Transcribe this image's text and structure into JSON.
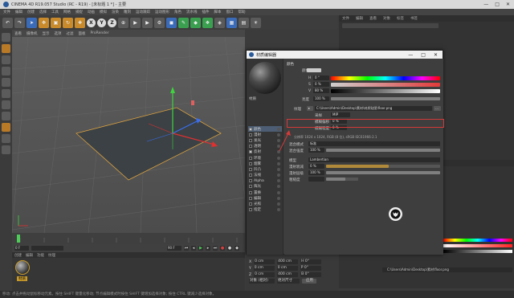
{
  "window": {
    "title": "CINEMA 4D R19.057 Studio (RC - R19) - [未标题 1 *] - 主要",
    "buttons": [
      "—",
      "□",
      "✕"
    ]
  },
  "menubar": [
    "文件",
    "编辑",
    "创建",
    "选择",
    "工具",
    "网格",
    "捕捉",
    "动画",
    "模拟",
    "渲染",
    "雕刻",
    "运动跟踪",
    "运动图形",
    "角色",
    "流水线",
    "插件",
    "脚本",
    "窗口",
    "帮助"
  ],
  "toolbar": {
    "xyz": [
      "X",
      "Y",
      "Z"
    ]
  },
  "viewport": {
    "menu": [
      "查看",
      "摄像机",
      "显示",
      "选项",
      "过滤",
      "面板",
      "ProRender"
    ]
  },
  "timeline": {
    "start_field": "0 F",
    "end_field": "90 F",
    "current_field": "90 F"
  },
  "material_manager": {
    "menu": [
      "创建",
      "编辑",
      "功能",
      "纹理"
    ],
    "material_label": "材质"
  },
  "coordinates": {
    "rows": [
      {
        "axis": "X",
        "pos": "0 cm",
        "size": "400 cm",
        "rot": "H 0°"
      },
      {
        "axis": "Y",
        "pos": "0 cm",
        "size": "0 cm",
        "rot": "P 0°"
      },
      {
        "axis": "Z",
        "pos": "0 cm",
        "size": "400 cm",
        "rot": "B 0°"
      }
    ],
    "mode": "对象 (相对)",
    "size_mode": "绝对尺寸",
    "apply": "应用"
  },
  "status": "移动: 点击并拖动鼠标移动元素。按住 SHIFT 键量化移动; 节点编辑模式时按住 SHIFT 键增加选择对象; 按住 CTRL 键减少选择对象。",
  "dialog": {
    "title": "材质编辑器",
    "controls": [
      "—",
      "□",
      "✕"
    ],
    "material_name": "材质",
    "channels": [
      {
        "label": "颜色",
        "on": true,
        "selected": true
      },
      {
        "label": "漫射",
        "on": false
      },
      {
        "label": "发光",
        "on": false
      },
      {
        "label": "透明",
        "on": false
      },
      {
        "label": "反射",
        "on": true
      },
      {
        "label": "环境",
        "on": false
      },
      {
        "label": "烟雾",
        "on": false
      },
      {
        "label": "凹凸",
        "on": false
      },
      {
        "label": "法线",
        "on": false
      },
      {
        "label": "Alpha",
        "on": false
      },
      {
        "label": "辉光",
        "on": false
      },
      {
        "label": "置换",
        "on": false
      },
      {
        "label": "编辑",
        "on": false
      },
      {
        "label": "光照",
        "on": false
      },
      {
        "label": "指定",
        "on": false
      }
    ],
    "color_section": "颜色",
    "color_label": "颜色",
    "hsv": [
      {
        "label": "H",
        "value": "0 °"
      },
      {
        "label": "S",
        "value": "0 %"
      },
      {
        "label": "V",
        "value": "80 %"
      }
    ],
    "brightness_label": "亮度",
    "brightness_value": "100 %",
    "texture_label": "纹理",
    "texture_path": "C:\\Users\\Admin\\Desktop\\素材\\材质贴图\\floor.png",
    "sampling_label": "采样",
    "sampling_value": "MIP",
    "blur_offset_label": "模糊偏移",
    "blur_offset_value": "0 %",
    "blur_scale_label": "模糊程度",
    "blur_scale_value": "0 %",
    "res_info": "分辨率 1024 x 1024, RGB (8 位), sRGB IEC61966-2.1",
    "mix_mode_label": "混合模式",
    "mix_mode_value": "标准",
    "mix_strength_label": "混合强度",
    "mix_strength_value": "100 %",
    "model_label": "模型",
    "model_value": "Lambertian",
    "roughness_label": "漫射衰减",
    "roughness_value": "0 %",
    "diffuse_label": "漫射层级",
    "diffuse_value": "100 %",
    "sublabel": "粗糙度"
  },
  "right_panel": {
    "tabs": [
      "文件",
      "编辑",
      "查看",
      "对象",
      "标签",
      "书签"
    ],
    "attr_tabs": [
      "模式",
      "编辑",
      "用户数据"
    ],
    "attr_path": "C:\\Users\\Admin\\Desktop\\素材\\floor.png"
  }
}
